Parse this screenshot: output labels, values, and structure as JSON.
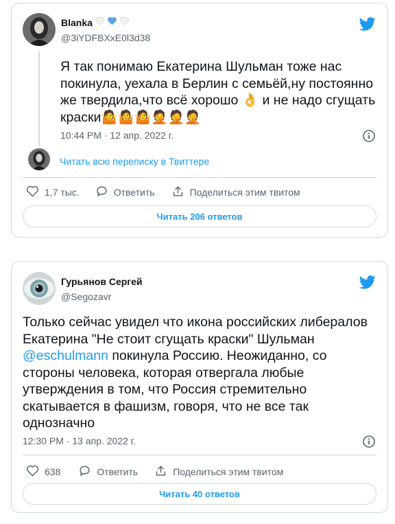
{
  "colors": {
    "accent": "#1d9bf0",
    "muted": "#536471",
    "border": "#cfd9de",
    "heart_emoji": "#5aa0e8"
  },
  "tweet1": {
    "display_name": "Blanka",
    "name_emojis": [
      "white-heart",
      "blue-heart",
      "white-heart"
    ],
    "handle": "@3iYDFBXxE0l3d38",
    "text": "Я так понимаю Екатерина Шульман тоже нас покинула, уехала в Берлин с семьёй,ну постоянно же твердила,что всё хорошо 👌 и не надо сгущать краски🤷🤷🤷🤦🤦🤦",
    "timestamp": "10:44 PM · 12 апр. 2022 г.",
    "read_thread_label": "Читать всю переписку в Твиттере",
    "like_count": "1,7 тыс.",
    "reply_label": "Ответить",
    "share_label": "Поделиться этим твитом",
    "read_replies_label": "Читать 206 ответов"
  },
  "tweet2": {
    "display_name": "Гурьянов Сергей",
    "handle": "@Segozavr",
    "text_before": "Только сейчас увидел что икона российских либералов Екатерина \"Не стоит сгущать краски\" Шульман ",
    "mention": "@eschulmann",
    "text_after": " покинула Россию. Неожиданно, со стороны человека, которая отвергала любые утверждения в том, что Россия стремительно скатывается в фашизм, говоря, что не все так однозначно",
    "timestamp": "12:30 PM · 13 апр. 2022 г.",
    "like_count": "638",
    "reply_label": "Ответить",
    "share_label": "Поделиться этим твитом",
    "read_replies_label": "Читать 40 ответов"
  }
}
